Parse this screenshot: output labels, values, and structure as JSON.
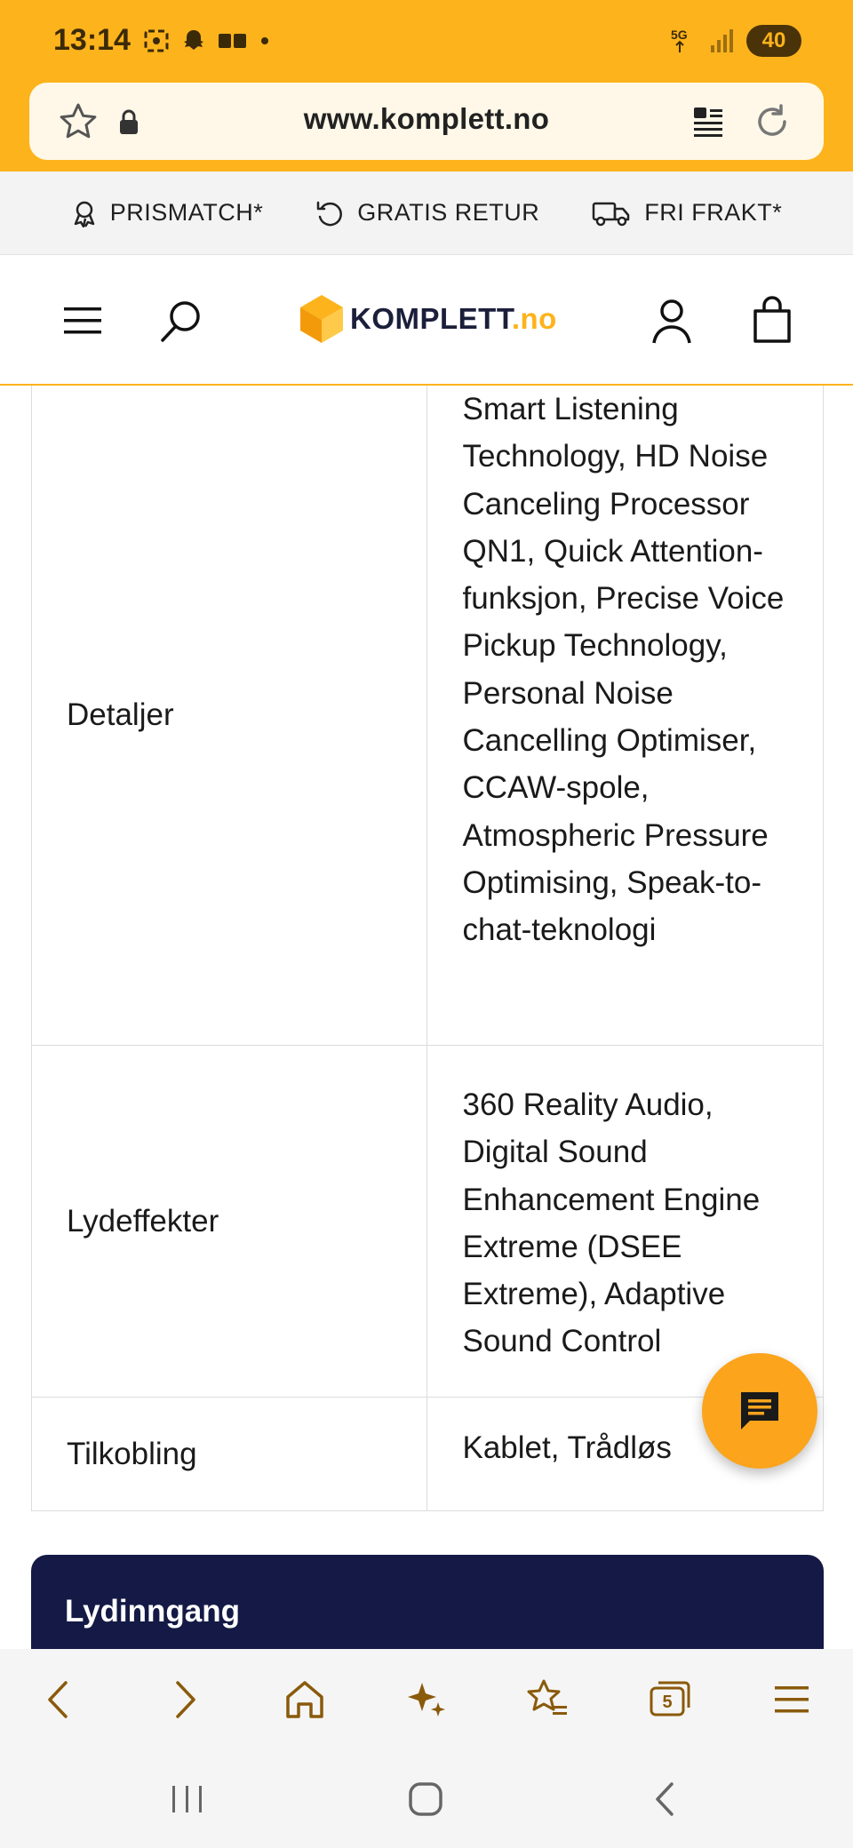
{
  "status_bar": {
    "time": "13:14",
    "network": "5G",
    "battery": "40"
  },
  "url_bar": {
    "url": "www.komplett.no"
  },
  "features": [
    {
      "icon": "award-icon",
      "label": "PRISMATCH*"
    },
    {
      "icon": "return-icon",
      "label": "GRATIS RETUR"
    },
    {
      "icon": "truck-icon",
      "label": "FRI FRAKT*"
    }
  ],
  "header": {
    "logo_main": "KOMPLETT",
    "logo_suffix": ".no"
  },
  "specs": [
    {
      "key": "Detaljer",
      "value": "Smart Listening Technology, HD Noise Canceling Processor QN1, Quick Attention-funksjon, Precise Voice Pickup Technology, Personal Noise Cancelling Optimiser, CCAW-spole, Atmospheric Pressure Optimising, Speak-to-chat-teknologi"
    },
    {
      "key": "Lydeffekter",
      "value": "360 Reality Audio, Digital Sound Enhancement Engine Extreme (DSEE Extreme), Adaptive Sound Control"
    },
    {
      "key": "Tilkobling",
      "value": "Kablet, Trådløs"
    }
  ],
  "section": {
    "title": "Lydinngang"
  },
  "browser_nav": {
    "tab_count": "5"
  },
  "colors": {
    "brand": "#fdb31c",
    "dark_section": "#141a45",
    "fab": "#fba41c"
  }
}
